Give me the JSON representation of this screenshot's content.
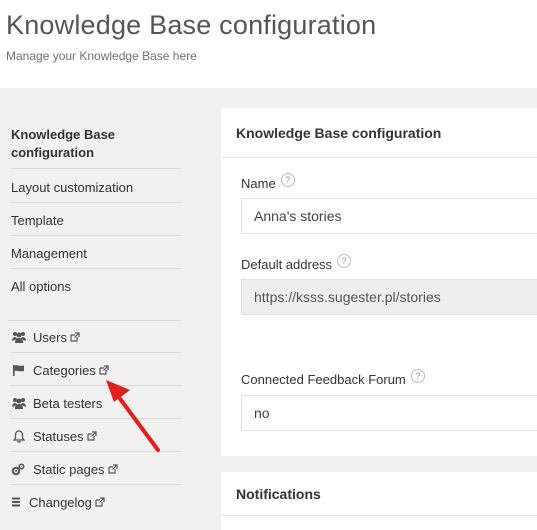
{
  "header": {
    "title": "Knowledge Base configuration",
    "subtitle": "Manage your Knowledge Base here"
  },
  "sidebar": {
    "settings": [
      {
        "label": "Knowledge Base configuration",
        "active": true
      },
      {
        "label": "Layout customization"
      },
      {
        "label": "Template"
      },
      {
        "label": "Management"
      },
      {
        "label": "All options"
      }
    ],
    "links": [
      {
        "label": "Users",
        "icon": "users-icon",
        "external": true
      },
      {
        "label": "Categories",
        "icon": "flag-icon",
        "external": true
      },
      {
        "label": "Beta testers",
        "icon": "users-icon",
        "external": false
      },
      {
        "label": "Statuses",
        "icon": "bell-icon",
        "external": true
      },
      {
        "label": "Static pages",
        "icon": "cogs-icon",
        "external": true
      },
      {
        "label": "Changelog",
        "icon": "list-icon",
        "external": true
      }
    ]
  },
  "panel": {
    "title": "Knowledge Base configuration",
    "fields": {
      "name": {
        "label": "Name",
        "value": "Anna's stories"
      },
      "address": {
        "label": "Default address",
        "value": "https://ksss.sugester.pl/stories"
      },
      "forum": {
        "label": "Connected Feedback Forum",
        "value": "no"
      }
    }
  },
  "notifications": {
    "title": "Notifications"
  },
  "colors": {
    "arrow": "#e0201c",
    "sidebar_bg": "#f1f1f1",
    "readonly_bg": "#eeeeee"
  }
}
